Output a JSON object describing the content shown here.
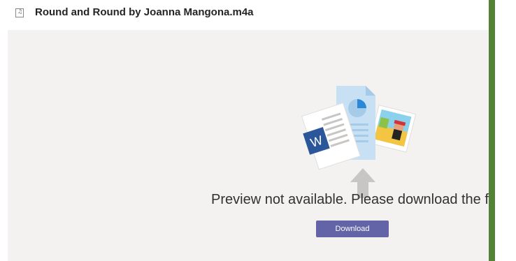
{
  "header": {
    "file_icon": "audio-file-icon",
    "file_icon_glyph": "♫",
    "file_name": "Round and Round by Joanna Mangona.m4a"
  },
  "preview": {
    "illustration_icon": "documents-upload-illustration",
    "word_letter": "W",
    "message": "Preview not available. Please download the file",
    "download_label": "Download"
  },
  "colors": {
    "accent": "#6264a7",
    "preview_background": "#f3f2f1",
    "side_bar": "#538135"
  }
}
